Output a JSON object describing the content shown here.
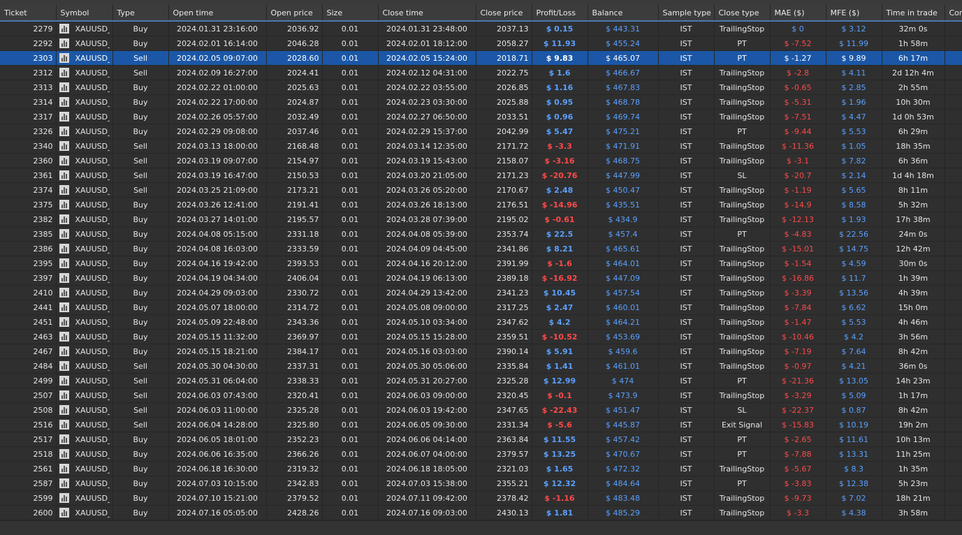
{
  "headers": [
    "Ticket",
    "Symbol",
    "Type",
    "Open time",
    "Open price",
    "Size",
    "Close time",
    "Close price",
    "Profit/Loss",
    "Balance",
    "Sample type",
    "Close type",
    "MAE ($)",
    "MFE ($)",
    "Time in trade",
    "Com"
  ],
  "selected_ticket": "2303",
  "colors": {
    "selection": "#1b57a6",
    "positive": "#5aa0ff",
    "negative": "#ff4a4a",
    "header_underline": "#4a78b0"
  },
  "rows": [
    {
      "ticket": "2279",
      "symbol": "XAUUSD_TI...",
      "type": "Buy",
      "open_time": "2024.01.31 23:16:00",
      "open_price": "2036.92",
      "size": "0.01",
      "close_time": "2024.01.31 23:48:00",
      "close_price": "2037.13",
      "pl": "$ 0.15",
      "balance": "$ 443.31",
      "sample": "IST",
      "close_type": "TrailingStop",
      "mae": "$ 0",
      "mfe": "$ 3.12",
      "time": "32m 0s"
    },
    {
      "ticket": "2292",
      "symbol": "XAUUSD_TI...",
      "type": "Buy",
      "open_time": "2024.02.01 16:14:00",
      "open_price": "2046.28",
      "size": "0.01",
      "close_time": "2024.02.01 18:12:00",
      "close_price": "2058.27",
      "pl": "$ 11.93",
      "balance": "$ 455.24",
      "sample": "IST",
      "close_type": "PT",
      "mae": "$ -7.52",
      "mfe": "$ 11.99",
      "time": "1h 58m"
    },
    {
      "ticket": "2303",
      "symbol": "XAUUSD_TI...",
      "type": "Sell",
      "open_time": "2024.02.05 09:07:00",
      "open_price": "2028.60",
      "size": "0.01",
      "close_time": "2024.02.05 15:24:00",
      "close_price": "2018.71",
      "pl": "$ 9.83",
      "balance": "$ 465.07",
      "sample": "IST",
      "close_type": "PT",
      "mae": "$ -1.27",
      "mfe": "$ 9.89",
      "time": "6h 17m"
    },
    {
      "ticket": "2312",
      "symbol": "XAUUSD_TI...",
      "type": "Sell",
      "open_time": "2024.02.09 16:27:00",
      "open_price": "2024.41",
      "size": "0.01",
      "close_time": "2024.02.12 04:31:00",
      "close_price": "2022.75",
      "pl": "$ 1.6",
      "balance": "$ 466.67",
      "sample": "IST",
      "close_type": "TrailingStop",
      "mae": "$ -2.8",
      "mfe": "$ 4.11",
      "time": "2d 12h 4m"
    },
    {
      "ticket": "2313",
      "symbol": "XAUUSD_TI...",
      "type": "Buy",
      "open_time": "2024.02.22 01:00:00",
      "open_price": "2025.63",
      "size": "0.01",
      "close_time": "2024.02.22 03:55:00",
      "close_price": "2026.85",
      "pl": "$ 1.16",
      "balance": "$ 467.83",
      "sample": "IST",
      "close_type": "TrailingStop",
      "mae": "$ -0.65",
      "mfe": "$ 2.85",
      "time": "2h 55m"
    },
    {
      "ticket": "2314",
      "symbol": "XAUUSD_TI...",
      "type": "Buy",
      "open_time": "2024.02.22 17:00:00",
      "open_price": "2024.87",
      "size": "0.01",
      "close_time": "2024.02.23 03:30:00",
      "close_price": "2025.88",
      "pl": "$ 0.95",
      "balance": "$ 468.78",
      "sample": "IST",
      "close_type": "TrailingStop",
      "mae": "$ -5.31",
      "mfe": "$ 1.96",
      "time": "10h 30m"
    },
    {
      "ticket": "2317",
      "symbol": "XAUUSD_TI...",
      "type": "Buy",
      "open_time": "2024.02.26 05:57:00",
      "open_price": "2032.49",
      "size": "0.01",
      "close_time": "2024.02.27 06:50:00",
      "close_price": "2033.51",
      "pl": "$ 0.96",
      "balance": "$ 469.74",
      "sample": "IST",
      "close_type": "TrailingStop",
      "mae": "$ -7.51",
      "mfe": "$ 4.47",
      "time": "1d 0h 53m"
    },
    {
      "ticket": "2326",
      "symbol": "XAUUSD_TI...",
      "type": "Buy",
      "open_time": "2024.02.29 09:08:00",
      "open_price": "2037.46",
      "size": "0.01",
      "close_time": "2024.02.29 15:37:00",
      "close_price": "2042.99",
      "pl": "$ 5.47",
      "balance": "$ 475.21",
      "sample": "IST",
      "close_type": "PT",
      "mae": "$ -9.44",
      "mfe": "$ 5.53",
      "time": "6h 29m"
    },
    {
      "ticket": "2340",
      "symbol": "XAUUSD_TI...",
      "type": "Sell",
      "open_time": "2024.03.13 18:00:00",
      "open_price": "2168.48",
      "size": "0.01",
      "close_time": "2024.03.14 12:35:00",
      "close_price": "2171.72",
      "pl": "$ -3.3",
      "balance": "$ 471.91",
      "sample": "IST",
      "close_type": "TrailingStop",
      "mae": "$ -11.36",
      "mfe": "$ 1.05",
      "time": "18h 35m"
    },
    {
      "ticket": "2360",
      "symbol": "XAUUSD_TI...",
      "type": "Sell",
      "open_time": "2024.03.19 09:07:00",
      "open_price": "2154.97",
      "size": "0.01",
      "close_time": "2024.03.19 15:43:00",
      "close_price": "2158.07",
      "pl": "$ -3.16",
      "balance": "$ 468.75",
      "sample": "IST",
      "close_type": "TrailingStop",
      "mae": "$ -3.1",
      "mfe": "$ 7.82",
      "time": "6h 36m"
    },
    {
      "ticket": "2361",
      "symbol": "XAUUSD_TI...",
      "type": "Sell",
      "open_time": "2024.03.19 16:47:00",
      "open_price": "2150.53",
      "size": "0.01",
      "close_time": "2024.03.20 21:05:00",
      "close_price": "2171.23",
      "pl": "$ -20.76",
      "balance": "$ 447.99",
      "sample": "IST",
      "close_type": "SL",
      "mae": "$ -20.7",
      "mfe": "$ 2.14",
      "time": "1d 4h 18m"
    },
    {
      "ticket": "2374",
      "symbol": "XAUUSD_TI...",
      "type": "Sell",
      "open_time": "2024.03.25 21:09:00",
      "open_price": "2173.21",
      "size": "0.01",
      "close_time": "2024.03.26 05:20:00",
      "close_price": "2170.67",
      "pl": "$ 2.48",
      "balance": "$ 450.47",
      "sample": "IST",
      "close_type": "TrailingStop",
      "mae": "$ -1.19",
      "mfe": "$ 5.65",
      "time": "8h 11m"
    },
    {
      "ticket": "2375",
      "symbol": "XAUUSD_TI...",
      "type": "Buy",
      "open_time": "2024.03.26 12:41:00",
      "open_price": "2191.41",
      "size": "0.01",
      "close_time": "2024.03.26 18:13:00",
      "close_price": "2176.51",
      "pl": "$ -14.96",
      "balance": "$ 435.51",
      "sample": "IST",
      "close_type": "TrailingStop",
      "mae": "$ -14.9",
      "mfe": "$ 8.58",
      "time": "5h 32m"
    },
    {
      "ticket": "2382",
      "symbol": "XAUUSD_TI...",
      "type": "Buy",
      "open_time": "2024.03.27 14:01:00",
      "open_price": "2195.57",
      "size": "0.01",
      "close_time": "2024.03.28 07:39:00",
      "close_price": "2195.02",
      "pl": "$ -0.61",
      "balance": "$ 434.9",
      "sample": "IST",
      "close_type": "TrailingStop",
      "mae": "$ -12.13",
      "mfe": "$ 1.93",
      "time": "17h 38m"
    },
    {
      "ticket": "2385",
      "symbol": "XAUUSD_TI...",
      "type": "Buy",
      "open_time": "2024.04.08 05:15:00",
      "open_price": "2331.18",
      "size": "0.01",
      "close_time": "2024.04.08 05:39:00",
      "close_price": "2353.74",
      "pl": "$ 22.5",
      "balance": "$ 457.4",
      "sample": "IST",
      "close_type": "PT",
      "mae": "$ -4.83",
      "mfe": "$ 22.56",
      "time": "24m 0s"
    },
    {
      "ticket": "2386",
      "symbol": "XAUUSD_TI...",
      "type": "Buy",
      "open_time": "2024.04.08 16:03:00",
      "open_price": "2333.59",
      "size": "0.01",
      "close_time": "2024.04.09 04:45:00",
      "close_price": "2341.86",
      "pl": "$ 8.21",
      "balance": "$ 465.61",
      "sample": "IST",
      "close_type": "TrailingStop",
      "mae": "$ -15.01",
      "mfe": "$ 14.75",
      "time": "12h 42m"
    },
    {
      "ticket": "2395",
      "symbol": "XAUUSD_TI...",
      "type": "Buy",
      "open_time": "2024.04.16 19:42:00",
      "open_price": "2393.53",
      "size": "0.01",
      "close_time": "2024.04.16 20:12:00",
      "close_price": "2391.99",
      "pl": "$ -1.6",
      "balance": "$ 464.01",
      "sample": "IST",
      "close_type": "TrailingStop",
      "mae": "$ -1.54",
      "mfe": "$ 4.59",
      "time": "30m 0s"
    },
    {
      "ticket": "2397",
      "symbol": "XAUUSD_TI...",
      "type": "Buy",
      "open_time": "2024.04.19 04:34:00",
      "open_price": "2406.04",
      "size": "0.01",
      "close_time": "2024.04.19 06:13:00",
      "close_price": "2389.18",
      "pl": "$ -16.92",
      "balance": "$ 447.09",
      "sample": "IST",
      "close_type": "TrailingStop",
      "mae": "$ -16.86",
      "mfe": "$ 11.7",
      "time": "1h 39m"
    },
    {
      "ticket": "2410",
      "symbol": "XAUUSD_TI...",
      "type": "Buy",
      "open_time": "2024.04.29 09:03:00",
      "open_price": "2330.72",
      "size": "0.01",
      "close_time": "2024.04.29 13:42:00",
      "close_price": "2341.23",
      "pl": "$ 10.45",
      "balance": "$ 457.54",
      "sample": "IST",
      "close_type": "TrailingStop",
      "mae": "$ -3.39",
      "mfe": "$ 13.56",
      "time": "4h 39m"
    },
    {
      "ticket": "2441",
      "symbol": "XAUUSD_TI...",
      "type": "Buy",
      "open_time": "2024.05.07 18:00:00",
      "open_price": "2314.72",
      "size": "0.01",
      "close_time": "2024.05.08 09:00:00",
      "close_price": "2317.25",
      "pl": "$ 2.47",
      "balance": "$ 460.01",
      "sample": "IST",
      "close_type": "TrailingStop",
      "mae": "$ -7.84",
      "mfe": "$ 6.62",
      "time": "15h 0m"
    },
    {
      "ticket": "2451",
      "symbol": "XAUUSD_TI...",
      "type": "Buy",
      "open_time": "2024.05.09 22:48:00",
      "open_price": "2343.36",
      "size": "0.01",
      "close_time": "2024.05.10 03:34:00",
      "close_price": "2347.62",
      "pl": "$ 4.2",
      "balance": "$ 464.21",
      "sample": "IST",
      "close_type": "TrailingStop",
      "mae": "$ -1.47",
      "mfe": "$ 5.53",
      "time": "4h 46m"
    },
    {
      "ticket": "2463",
      "symbol": "XAUUSD_TI...",
      "type": "Buy",
      "open_time": "2024.05.15 11:32:00",
      "open_price": "2369.97",
      "size": "0.01",
      "close_time": "2024.05.15 15:28:00",
      "close_price": "2359.51",
      "pl": "$ -10.52",
      "balance": "$ 453.69",
      "sample": "IST",
      "close_type": "TrailingStop",
      "mae": "$ -10.46",
      "mfe": "$ 4.2",
      "time": "3h 56m"
    },
    {
      "ticket": "2467",
      "symbol": "XAUUSD_TI...",
      "type": "Buy",
      "open_time": "2024.05.15 18:21:00",
      "open_price": "2384.17",
      "size": "0.01",
      "close_time": "2024.05.16 03:03:00",
      "close_price": "2390.14",
      "pl": "$ 5.91",
      "balance": "$ 459.6",
      "sample": "IST",
      "close_type": "TrailingStop",
      "mae": "$ -7.19",
      "mfe": "$ 7.64",
      "time": "8h 42m"
    },
    {
      "ticket": "2484",
      "symbol": "XAUUSD_TI...",
      "type": "Sell",
      "open_time": "2024.05.30 04:30:00",
      "open_price": "2337.31",
      "size": "0.01",
      "close_time": "2024.05.30 05:06:00",
      "close_price": "2335.84",
      "pl": "$ 1.41",
      "balance": "$ 461.01",
      "sample": "IST",
      "close_type": "TrailingStop",
      "mae": "$ -0.97",
      "mfe": "$ 4.21",
      "time": "36m 0s"
    },
    {
      "ticket": "2499",
      "symbol": "XAUUSD_TI...",
      "type": "Sell",
      "open_time": "2024.05.31 06:04:00",
      "open_price": "2338.33",
      "size": "0.01",
      "close_time": "2024.05.31 20:27:00",
      "close_price": "2325.28",
      "pl": "$ 12.99",
      "balance": "$ 474",
      "sample": "IST",
      "close_type": "PT",
      "mae": "$ -21.36",
      "mfe": "$ 13.05",
      "time": "14h 23m"
    },
    {
      "ticket": "2507",
      "symbol": "XAUUSD_TI...",
      "type": "Sell",
      "open_time": "2024.06.03 07:43:00",
      "open_price": "2320.41",
      "size": "0.01",
      "close_time": "2024.06.03 09:00:00",
      "close_price": "2320.45",
      "pl": "$ -0.1",
      "balance": "$ 473.9",
      "sample": "IST",
      "close_type": "TrailingStop",
      "mae": "$ -3.29",
      "mfe": "$ 5.09",
      "time": "1h 17m"
    },
    {
      "ticket": "2508",
      "symbol": "XAUUSD_TI...",
      "type": "Sell",
      "open_time": "2024.06.03 11:00:00",
      "open_price": "2325.28",
      "size": "0.01",
      "close_time": "2024.06.03 19:42:00",
      "close_price": "2347.65",
      "pl": "$ -22.43",
      "balance": "$ 451.47",
      "sample": "IST",
      "close_type": "SL",
      "mae": "$ -22.37",
      "mfe": "$ 0.87",
      "time": "8h 42m"
    },
    {
      "ticket": "2516",
      "symbol": "XAUUSD_TI...",
      "type": "Sell",
      "open_time": "2024.06.04 14:28:00",
      "open_price": "2325.80",
      "size": "0.01",
      "close_time": "2024.06.05 09:30:00",
      "close_price": "2331.34",
      "pl": "$ -5.6",
      "balance": "$ 445.87",
      "sample": "IST",
      "close_type": "Exit Signal",
      "mae": "$ -15.83",
      "mfe": "$ 10.19",
      "time": "19h 2m"
    },
    {
      "ticket": "2517",
      "symbol": "XAUUSD_TI...",
      "type": "Buy",
      "open_time": "2024.06.05 18:01:00",
      "open_price": "2352.23",
      "size": "0.01",
      "close_time": "2024.06.06 04:14:00",
      "close_price": "2363.84",
      "pl": "$ 11.55",
      "balance": "$ 457.42",
      "sample": "IST",
      "close_type": "PT",
      "mae": "$ -2.65",
      "mfe": "$ 11.61",
      "time": "10h 13m"
    },
    {
      "ticket": "2518",
      "symbol": "XAUUSD_TI...",
      "type": "Buy",
      "open_time": "2024.06.06 16:35:00",
      "open_price": "2366.26",
      "size": "0.01",
      "close_time": "2024.06.07 04:00:00",
      "close_price": "2379.57",
      "pl": "$ 13.25",
      "balance": "$ 470.67",
      "sample": "IST",
      "close_type": "PT",
      "mae": "$ -7.88",
      "mfe": "$ 13.31",
      "time": "11h 25m"
    },
    {
      "ticket": "2561",
      "symbol": "XAUUSD_TI...",
      "type": "Buy",
      "open_time": "2024.06.18 16:30:00",
      "open_price": "2319.32",
      "size": "0.01",
      "close_time": "2024.06.18 18:05:00",
      "close_price": "2321.03",
      "pl": "$ 1.65",
      "balance": "$ 472.32",
      "sample": "IST",
      "close_type": "TrailingStop",
      "mae": "$ -5.67",
      "mfe": "$ 8.3",
      "time": "1h 35m"
    },
    {
      "ticket": "2587",
      "symbol": "XAUUSD_TI...",
      "type": "Buy",
      "open_time": "2024.07.03 10:15:00",
      "open_price": "2342.83",
      "size": "0.01",
      "close_time": "2024.07.03 15:38:00",
      "close_price": "2355.21",
      "pl": "$ 12.32",
      "balance": "$ 484.64",
      "sample": "IST",
      "close_type": "PT",
      "mae": "$ -3.83",
      "mfe": "$ 12.38",
      "time": "5h 23m"
    },
    {
      "ticket": "2599",
      "symbol": "XAUUSD_TI...",
      "type": "Buy",
      "open_time": "2024.07.10 15:21:00",
      "open_price": "2379.52",
      "size": "0.01",
      "close_time": "2024.07.11 09:42:00",
      "close_price": "2378.42",
      "pl": "$ -1.16",
      "balance": "$ 483.48",
      "sample": "IST",
      "close_type": "TrailingStop",
      "mae": "$ -9.73",
      "mfe": "$ 7.02",
      "time": "18h 21m"
    },
    {
      "ticket": "2600",
      "symbol": "XAUUSD_TI...",
      "type": "Buy",
      "open_time": "2024.07.16 05:05:00",
      "open_price": "2428.26",
      "size": "0.01",
      "close_time": "2024.07.16 09:03:00",
      "close_price": "2430.13",
      "pl": "$ 1.81",
      "balance": "$ 485.29",
      "sample": "IST",
      "close_type": "TrailingStop",
      "mae": "$ -3.3",
      "mfe": "$ 4.38",
      "time": "3h 58m"
    }
  ]
}
